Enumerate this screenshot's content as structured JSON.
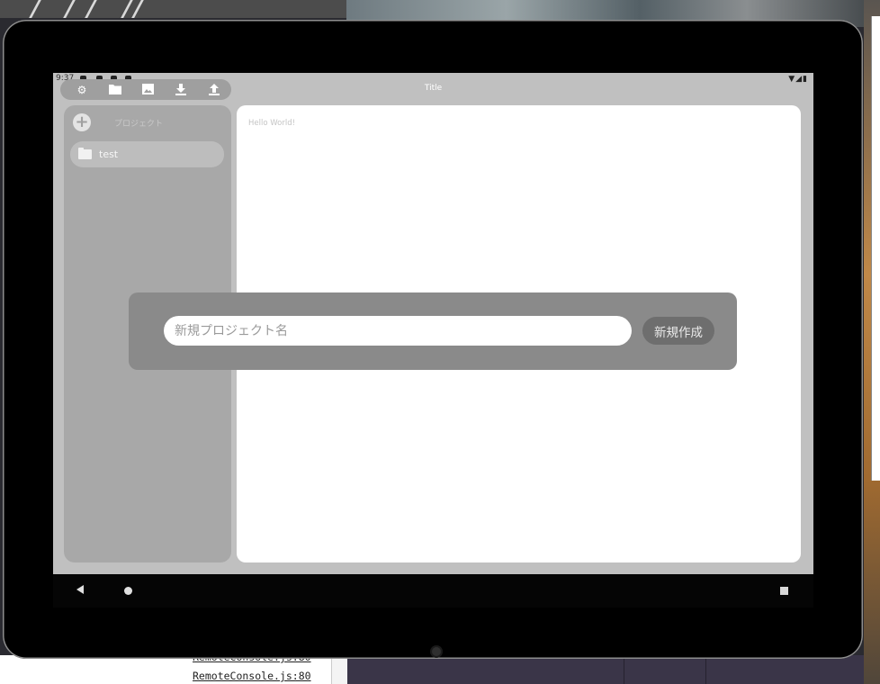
{
  "statusbar": {
    "time": "9:37",
    "indicators": "▼◢▮"
  },
  "toolbar": {
    "buttons": [
      {
        "icon": "gear-icon"
      },
      {
        "icon": "folder-icon"
      },
      {
        "icon": "image-icon"
      },
      {
        "icon": "download-icon"
      },
      {
        "icon": "upload-icon"
      }
    ]
  },
  "app": {
    "title": "Title"
  },
  "sidebar": {
    "heading": "プロジェクト",
    "add_icon": "+",
    "projects": [
      {
        "label": "test",
        "icon": "folder-icon"
      }
    ]
  },
  "main": {
    "text": "Hello World!"
  },
  "dialog": {
    "input_placeholder": "新規プロジェクト名",
    "create_label": "新規作成"
  },
  "console": {
    "link_partial": "RemoteConsole.js:80",
    "link": "RemoteConsole.js:80"
  },
  "colors": {
    "screen_bg": "#c0c0c0",
    "dialog_bg": "#8a8a8a",
    "button_bg": "#6e6e6e"
  }
}
